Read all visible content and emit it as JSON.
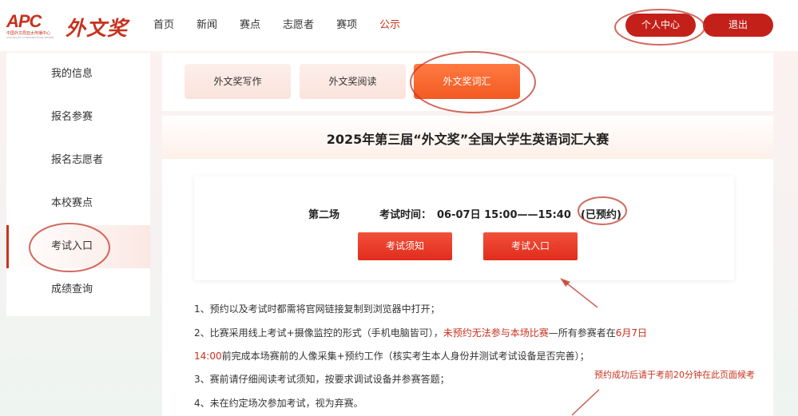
{
  "header": {
    "logo": {
      "apc": "APC",
      "org": "中国外文局亚太传播中心",
      "org_en": "ASIA-PACIFIC COMMUNICATION CENTER",
      "brand": "外文奖"
    },
    "nav": [
      "首页",
      "新闻",
      "赛点",
      "志愿者",
      "赛项",
      "公示"
    ],
    "active_nav": "公示",
    "user_center": "个人中心",
    "logout": "退出"
  },
  "sidebar": {
    "items": [
      {
        "label": "我的信息"
      },
      {
        "label": "报名参赛"
      },
      {
        "label": "报名志愿者"
      },
      {
        "label": "本校赛点"
      },
      {
        "label": "考试入口"
      },
      {
        "label": "成绩查询"
      }
    ],
    "active": "考试入口"
  },
  "tabs": [
    {
      "label": "外文奖写作"
    },
    {
      "label": "外文奖阅读"
    },
    {
      "label": "外文奖词汇"
    }
  ],
  "active_tab": "外文奖词汇",
  "main": {
    "title": "2025年第三届“外文奖”全国大学生英语词汇大赛",
    "session": {
      "name": "第二场",
      "time_label": "考试时间：",
      "time": "06-07日 15:00——15:40",
      "status": "(已预约)"
    },
    "buttons": {
      "notice": "考试须知",
      "enter": "考试入口"
    },
    "notes": {
      "n1": "1、预约以及考试时都需将官网链接复制到浏览器中打开；",
      "n2_a": "2、比赛采用线上考试+摄像监控的形式（手机电脑皆可），",
      "n2_red": "未预约无法参与本场比赛",
      "n2_b": "—所有参赛者在",
      "n2_red2": "6月7日",
      "n2b_red": "14:00",
      "n2b_rest": "前完成本场赛前的人像采集+预约工作（核实考生本人身份并测试考试设备是否完善）；",
      "n3": "3、赛前请仔细阅读考试须知，按要求调试设备并参赛答题；",
      "n4": "4、未在约定场次参加考试，视为弃赛。"
    }
  },
  "annotation": {
    "text": "预约成功后请于考前20分钟在此页面候考",
    "color": "#c8321e"
  },
  "colors": {
    "brand_red": "#c8321e",
    "button_red": "#e02c1c",
    "tab_active": "#f25a22"
  }
}
